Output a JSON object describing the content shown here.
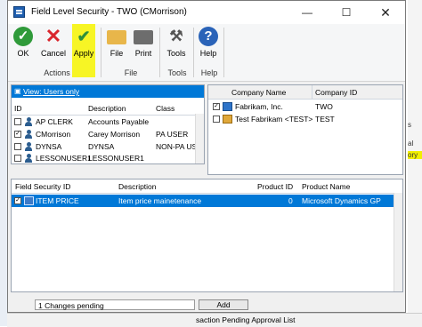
{
  "window": {
    "title": "Field Level Security - TWO (CMorrison)"
  },
  "ribbon": {
    "buttons": [
      {
        "label": "OK"
      },
      {
        "label": "Cancel"
      },
      {
        "label": "Apply"
      },
      {
        "label": "File"
      },
      {
        "label": "Print"
      },
      {
        "label": "Tools"
      },
      {
        "label": "Help"
      }
    ],
    "groups": [
      "Actions",
      "File",
      "Tools",
      "Help"
    ]
  },
  "users": {
    "view_label": "View: Users only",
    "columns": [
      "ID",
      "Description",
      "Class"
    ],
    "rows": [
      {
        "id": "AP CLERK",
        "description": "Accounts Payable",
        "class": "",
        "checked": false
      },
      {
        "id": "CMorrison",
        "description": "Carey Morrison",
        "class": "PA USER",
        "checked": true
      },
      {
        "id": "DYNSA",
        "description": "DYNSA",
        "class": "NON-PA US",
        "checked": false
      },
      {
        "id": "LESSONUSER1",
        "description": "LESSONUSER1",
        "class": "",
        "checked": false
      }
    ]
  },
  "companies": {
    "columns": [
      "Company Name",
      "Company ID"
    ],
    "rows": [
      {
        "name": "Fabrikam, Inc.",
        "id": "TWO",
        "checked": true
      },
      {
        "name": "Test Fabrikam <TEST>",
        "id": "TEST",
        "checked": false
      }
    ]
  },
  "fields": {
    "columns": [
      "Field Security ID",
      "Description",
      "Product ID",
      "Product Name"
    ],
    "rows": [
      {
        "id": "ITEM PRICE",
        "description": "Item price mainetenance",
        "product_id": "0",
        "product_name": "Microsoft Dynamics GP",
        "checked": true
      }
    ]
  },
  "status": {
    "pending": "1 Changes pending",
    "add_label": "Add"
  },
  "background": {
    "right_text": [
      "s",
      "al",
      "ory"
    ],
    "bottom_text": "saction Pending Approval List"
  },
  "colors": {
    "selection": "#0078d7",
    "accent": "#1f5fb0",
    "highlight": "#f7f500"
  }
}
